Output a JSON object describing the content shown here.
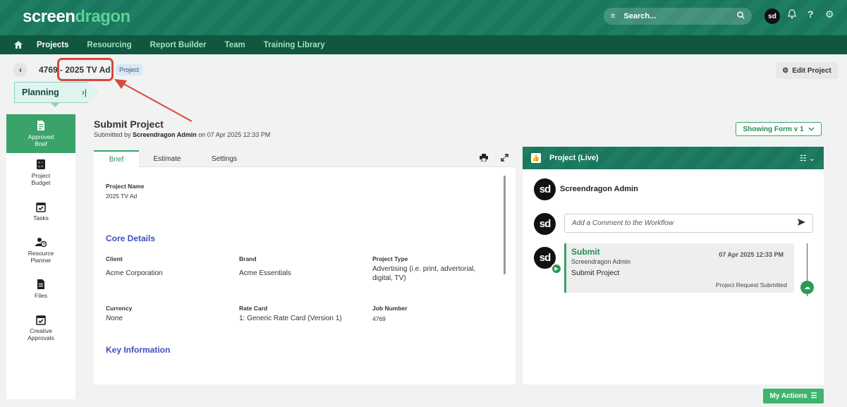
{
  "app": {
    "logo_part1": "screen",
    "logo_part2": "dragon",
    "search_placeholder": "Search...",
    "avatar_initials": "sd"
  },
  "nav": {
    "items": [
      {
        "label": "Projects",
        "active": true
      },
      {
        "label": "Resourcing",
        "active": false
      },
      {
        "label": "Report Builder",
        "active": false
      },
      {
        "label": "Team",
        "active": false
      },
      {
        "label": "Training Library",
        "active": false
      }
    ]
  },
  "project": {
    "id": "4769",
    "separator": " - ",
    "name": "2025 TV Ad",
    "badge": "Project",
    "edit_label": "Edit Project"
  },
  "stage": {
    "label": "Planning",
    "toggle": "›|"
  },
  "sidebar": {
    "items": [
      {
        "label": "Approved Brief",
        "icon": "document-icon",
        "active": true
      },
      {
        "label": "Project Budget",
        "icon": "calculator-icon",
        "active": false
      },
      {
        "label": "Tasks",
        "icon": "calendar-check-icon",
        "active": false
      },
      {
        "label": "Resource Planner",
        "icon": "user-clock-icon",
        "active": false
      },
      {
        "label": "Files",
        "icon": "file-icon",
        "active": false
      },
      {
        "label": "Creative Approvals",
        "icon": "calendar-check-icon",
        "active": false
      }
    ]
  },
  "form": {
    "title": "Submit Project",
    "submitted_prefix": "Submitted by ",
    "submitted_by": "Screendragon Admin",
    "submitted_suffix": " on 07 Apr 2025 12:33 PM",
    "showing_form": "Showing Form v 1"
  },
  "tabs": [
    {
      "label": "Brief",
      "active": true
    },
    {
      "label": "Estimate",
      "active": false
    },
    {
      "label": "Settings",
      "active": false
    }
  ],
  "brief": {
    "project_name_label": "Project Name",
    "project_name_value": "2025 TV Ad",
    "core_details_heading": "Core Details",
    "client_label": "Client",
    "client_value": "Acme Corporation",
    "brand_label": "Brand",
    "brand_value": "Acme Essentials",
    "project_type_label": "Project Type",
    "project_type_value_line1": "Advertising (i.e. print, advertorial,",
    "project_type_value_line2": "digital, TV)",
    "currency_label": "Currency",
    "currency_value": "None",
    "rate_card_label": "Rate Card",
    "rate_card_value": "1: Generic Rate Card (Version 1)",
    "job_number_label": "Job Number",
    "job_number_value": "4769",
    "key_info_heading": "Key Information"
  },
  "workflow": {
    "title": "Project (Live)",
    "user": "Screendragon Admin",
    "comment_placeholder": "Add a Comment to the Workflow",
    "event": {
      "title": "Submit",
      "user": "Screendragon Admin",
      "text": "Submit Project",
      "date": "07 Apr 2025 12:33 PM",
      "status": "Project Request Submitted"
    }
  },
  "my_actions_label": "My Actions",
  "colors": {
    "brand_green": "#1e7d62",
    "nav_dark": "#11573f",
    "accent_green": "#3aa36a",
    "section_blue": "#3d4fc4",
    "highlight_red": "#d8483a"
  }
}
